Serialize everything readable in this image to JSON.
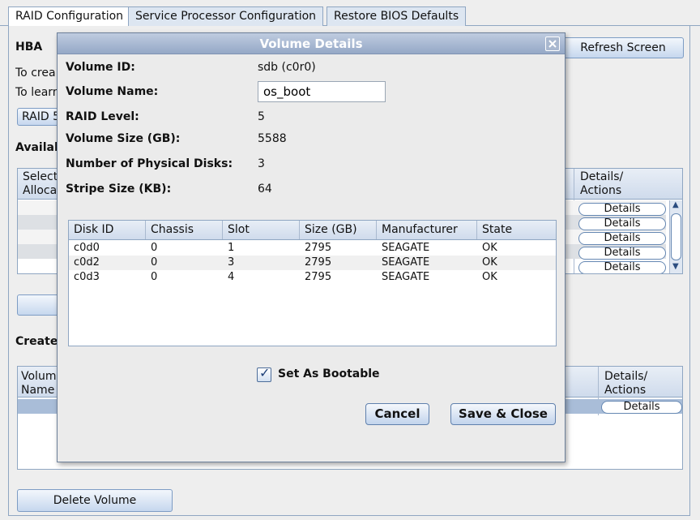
{
  "tabs": [
    "RAID Configuration",
    "Service Processor Configuration",
    "Restore BIOS Defaults"
  ],
  "background": {
    "hba_label": "HBA",
    "create_text_partial": "To crea",
    "learn_text_partial": "To learn",
    "raid_button_partial": "RAID 5",
    "available_partial": "Availal",
    "create_partial": "Create",
    "refresh_button": "Refresh Screen",
    "table1_select_header": "Select/\nAlloca",
    "table1_details_header": "Details/\nActions",
    "details_label": "Details",
    "table2_volume_header": "Volum\nName",
    "table2_details_header": "Details/\nActions",
    "delete_volume_button": "Delete Volume"
  },
  "modal": {
    "title": "Volume Details",
    "close_icon": "close-icon",
    "fields": {
      "volume_id_label": "Volume ID:",
      "volume_id_value": "sdb (c0r0)",
      "volume_name_label": "Volume Name:",
      "volume_name_value": "os_boot",
      "raid_level_label": "RAID Level:",
      "raid_level_value": "5",
      "volume_size_label": "Volume Size (GB):",
      "volume_size_value": "5588",
      "num_disks_label": "Number of Physical Disks:",
      "num_disks_value": "3",
      "stripe_size_label": "Stripe Size (KB):",
      "stripe_size_value": "64"
    },
    "disk_table": {
      "columns": [
        "Disk ID",
        "Chassis",
        "Slot",
        "Size (GB)",
        "Manufacturer",
        "State"
      ],
      "rows": [
        [
          "c0d0",
          "0",
          "1",
          "2795",
          "SEAGATE",
          "OK"
        ],
        [
          "c0d2",
          "0",
          "3",
          "2795",
          "SEAGATE",
          "OK"
        ],
        [
          "c0d3",
          "0",
          "4",
          "2795",
          "SEAGATE",
          "OK"
        ]
      ]
    },
    "bootable_label": "Set As Bootable",
    "bootable_checked": true,
    "cancel_button": "Cancel",
    "save_button": "Save & Close"
  },
  "colors": {
    "title_bar": "#95a8c6",
    "tab_border": "#8fa6c2",
    "selection": "#a9bdd8"
  }
}
